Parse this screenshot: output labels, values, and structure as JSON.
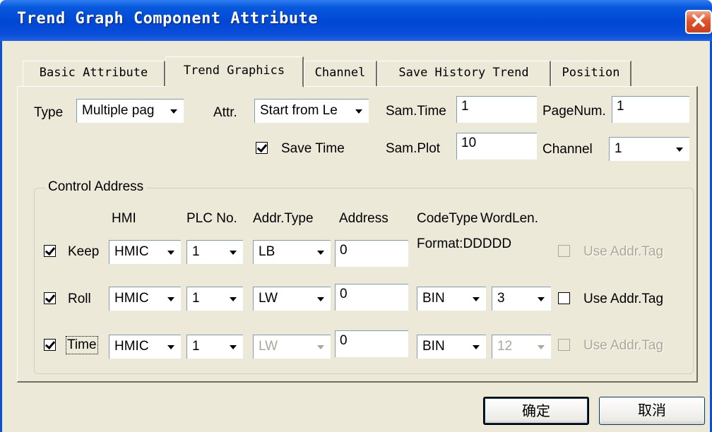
{
  "window": {
    "title": "Trend Graph Component Attribute",
    "close_glyph": "✕"
  },
  "tabs": [
    {
      "label": "Basic Attribute",
      "active": false
    },
    {
      "label": "Trend Graphics",
      "active": true
    },
    {
      "label": "Channel",
      "active": false
    },
    {
      "label": "Save History Trend",
      "active": false
    },
    {
      "label": "Position",
      "active": false
    }
  ],
  "settings": {
    "type_label": "Type",
    "type_value": "Multiple pag",
    "attr_label": "Attr.",
    "attr_value": "Start from Le",
    "samtime_label": "Sam.Time",
    "samtime_value": "1",
    "pagenum_label": "PageNum.",
    "pagenum_value": "1",
    "savetime_label": "Save Time",
    "savetime_checked": true,
    "samplot_label": "Sam.Plot",
    "samplot_value": "10",
    "channel_label": "Channel",
    "channel_value": "1"
  },
  "control_address": {
    "group_label": "Control Address",
    "headers": {
      "hmi": "HMI",
      "plc": "PLC No.",
      "addr_type": "Addr.Type",
      "address": "Address",
      "code_type": "CodeType",
      "word_len": "WordLen."
    },
    "format_text": "Format:DDDDD",
    "rows": [
      {
        "label": "Keep",
        "checked": true,
        "hmi": "HMIC",
        "plc": "1",
        "addr_type": "LB",
        "address": "0",
        "code_type": "",
        "word_len": "",
        "use_tag_label": "Use Addr.Tag",
        "use_tag_enabled": false
      },
      {
        "label": "Roll",
        "checked": true,
        "hmi": "HMIC",
        "plc": "1",
        "addr_type": "LW",
        "address": "0",
        "code_type": "BIN",
        "word_len": "3",
        "use_tag_label": "Use Addr.Tag",
        "use_tag_enabled": true
      },
      {
        "label": "Time",
        "checked": true,
        "hmi": "HMIC",
        "plc": "1",
        "addr_type": "LW",
        "address": "0",
        "code_type": "BIN",
        "word_len": "12",
        "use_tag_label": "Use Addr.Tag",
        "use_tag_enabled": false
      }
    ]
  },
  "buttons": {
    "ok": "确定",
    "cancel": "取消"
  },
  "icons": {
    "close": "close-icon",
    "dropdown": "chevron-down-icon",
    "checkbox": "checkmark-icon"
  },
  "colors": {
    "titlebar": "#0047d4",
    "dialog_bg": "#ece9d8",
    "close_button": "#e0542b",
    "disabled_text": "#aca899"
  }
}
